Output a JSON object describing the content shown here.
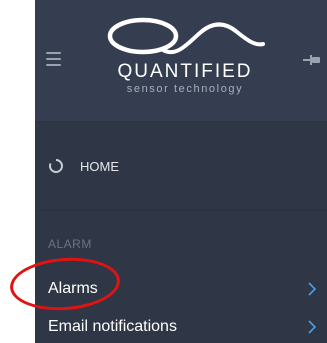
{
  "colors": {
    "sidebar_bg": "#2f3747",
    "header_bg": "#353e50",
    "accent_chevron": "#4a9ee8",
    "annotation_red": "#e11212"
  },
  "header": {
    "menu_icon": "hamburger-icon",
    "logo": {
      "mark_icon": "q-wave-logo",
      "name": "QUANTIFIED",
      "tagline": "sensor technology"
    },
    "pin_icon": "pin-icon"
  },
  "home": {
    "icon": "loading-ring-icon",
    "label": "HOME"
  },
  "nav": {
    "section_label": "ALARM",
    "items": [
      {
        "label": "Alarms",
        "icon": "chevron-right-icon"
      },
      {
        "label": "Email notifications",
        "icon": "chevron-right-icon"
      }
    ]
  }
}
